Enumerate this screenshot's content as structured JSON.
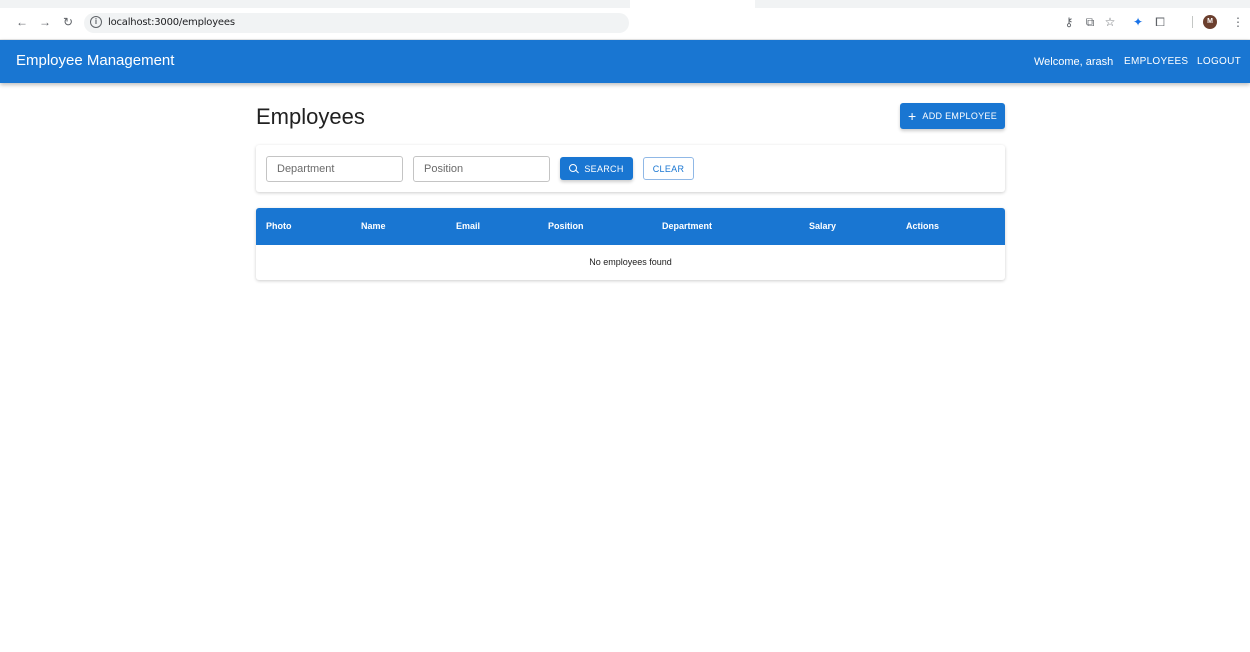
{
  "browser": {
    "url": "localhost:3000/employees",
    "avatar_letter": "M"
  },
  "appbar": {
    "brand": "Employee Management",
    "welcome": "Welcome, arash",
    "nav": [
      "EMPLOYEES",
      "LOGOUT"
    ],
    "color": "#1976d2"
  },
  "page": {
    "title": "Employees",
    "add_button": "ADD EMPLOYEE"
  },
  "filters": {
    "department_placeholder": "Department",
    "position_placeholder": "Position",
    "search_button": "SEARCH",
    "clear_button": "CLEAR"
  },
  "table": {
    "headers": [
      "Photo",
      "Name",
      "Email",
      "Position",
      "Department",
      "Salary",
      "Actions"
    ],
    "empty_message": "No employees found"
  }
}
